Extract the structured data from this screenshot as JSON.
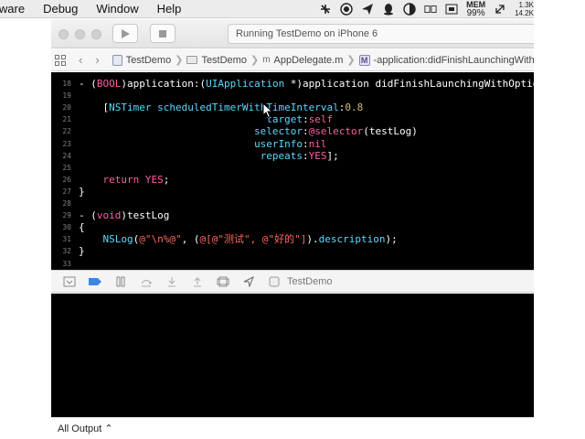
{
  "menubar": {
    "items": [
      "lware",
      "Debug",
      "Window",
      "Help"
    ],
    "mem_label": "MEM",
    "mem_value": "99%",
    "net_up": "1.3K",
    "net_down": "14.2K"
  },
  "toolbar": {
    "activity_text": "Running TestDemo on iPhone 6"
  },
  "jumpbar": {
    "crumbs": [
      "TestDemo",
      "TestDemo",
      "AppDelegate.m",
      "-application:didFinishLaunchingWithOptions:"
    ],
    "sep": "❯"
  },
  "editor": {
    "lines": [
      {
        "n": "18",
        "segs": [
          [
            "pl",
            "- ("
          ],
          [
            "kw",
            "BOOL"
          ],
          [
            "pl",
            ")application:("
          ],
          [
            "ty",
            "UIApplication"
          ],
          [
            "pl",
            " *)application didFinishLaunchingWithOptions:"
          ]
        ]
      },
      {
        "n": "19",
        "segs": []
      },
      {
        "n": "20",
        "segs": [
          [
            "pl",
            "    ["
          ],
          [
            "ty",
            "NSTimer"
          ],
          [
            "ty",
            " scheduledTimerWithTimeInterval"
          ],
          [
            "pl",
            ":"
          ],
          [
            "num",
            "0.8"
          ]
        ]
      },
      {
        "n": "21",
        "segs": [
          [
            "pl",
            "                               "
          ],
          [
            "ty",
            "target"
          ],
          [
            "pl",
            ":"
          ],
          [
            "kw",
            "self"
          ]
        ]
      },
      {
        "n": "22",
        "segs": [
          [
            "pl",
            "                             "
          ],
          [
            "ty",
            "selector"
          ],
          [
            "pl",
            ":"
          ],
          [
            "kw",
            "@selector"
          ],
          [
            "pl",
            "(testLog)"
          ]
        ]
      },
      {
        "n": "23",
        "segs": [
          [
            "pl",
            "                             "
          ],
          [
            "ty",
            "userInfo"
          ],
          [
            "pl",
            ":"
          ],
          [
            "kw",
            "nil"
          ]
        ]
      },
      {
        "n": "24",
        "segs": [
          [
            "pl",
            "                              "
          ],
          [
            "ty",
            "repeats"
          ],
          [
            "pl",
            ":"
          ],
          [
            "kw",
            "YES"
          ],
          [
            "pl",
            "];"
          ]
        ]
      },
      {
        "n": "25",
        "segs": []
      },
      {
        "n": "26",
        "segs": [
          [
            "pl",
            "    "
          ],
          [
            "kw",
            "return"
          ],
          [
            "pl",
            " "
          ],
          [
            "kw",
            "YES"
          ],
          [
            "pl",
            ";"
          ]
        ]
      },
      {
        "n": "27",
        "segs": [
          [
            "pl",
            "}"
          ]
        ]
      },
      {
        "n": "28",
        "segs": []
      },
      {
        "n": "29",
        "segs": [
          [
            "pl",
            "- ("
          ],
          [
            "kw",
            "void"
          ],
          [
            "pl",
            ")testLog"
          ]
        ]
      },
      {
        "n": "30",
        "segs": [
          [
            "pl",
            "{"
          ]
        ]
      },
      {
        "n": "31",
        "segs": [
          [
            "pl",
            "    "
          ],
          [
            "ty",
            "NSLog"
          ],
          [
            "pl",
            "("
          ],
          [
            "str",
            "@\"\\n%@\""
          ],
          [
            "pl",
            ", ("
          ],
          [
            "str",
            "@[@\"测试\", @\"好的\"]"
          ],
          [
            "pl",
            ")."
          ],
          [
            "ty",
            "description"
          ],
          [
            "pl",
            ");"
          ]
        ]
      },
      {
        "n": "32",
        "segs": [
          [
            "pl",
            "}"
          ]
        ]
      },
      {
        "n": "33",
        "segs": []
      }
    ]
  },
  "debugbar": {
    "target_label": "TestDemo"
  },
  "outputbar": {
    "label": "All Output ⌃"
  },
  "colors": {
    "keyword": "#fc5fa3",
    "type": "#5dd8ff",
    "string": "#fc6a5d",
    "number": "#d0bf69",
    "editor_bg": "#000000"
  }
}
